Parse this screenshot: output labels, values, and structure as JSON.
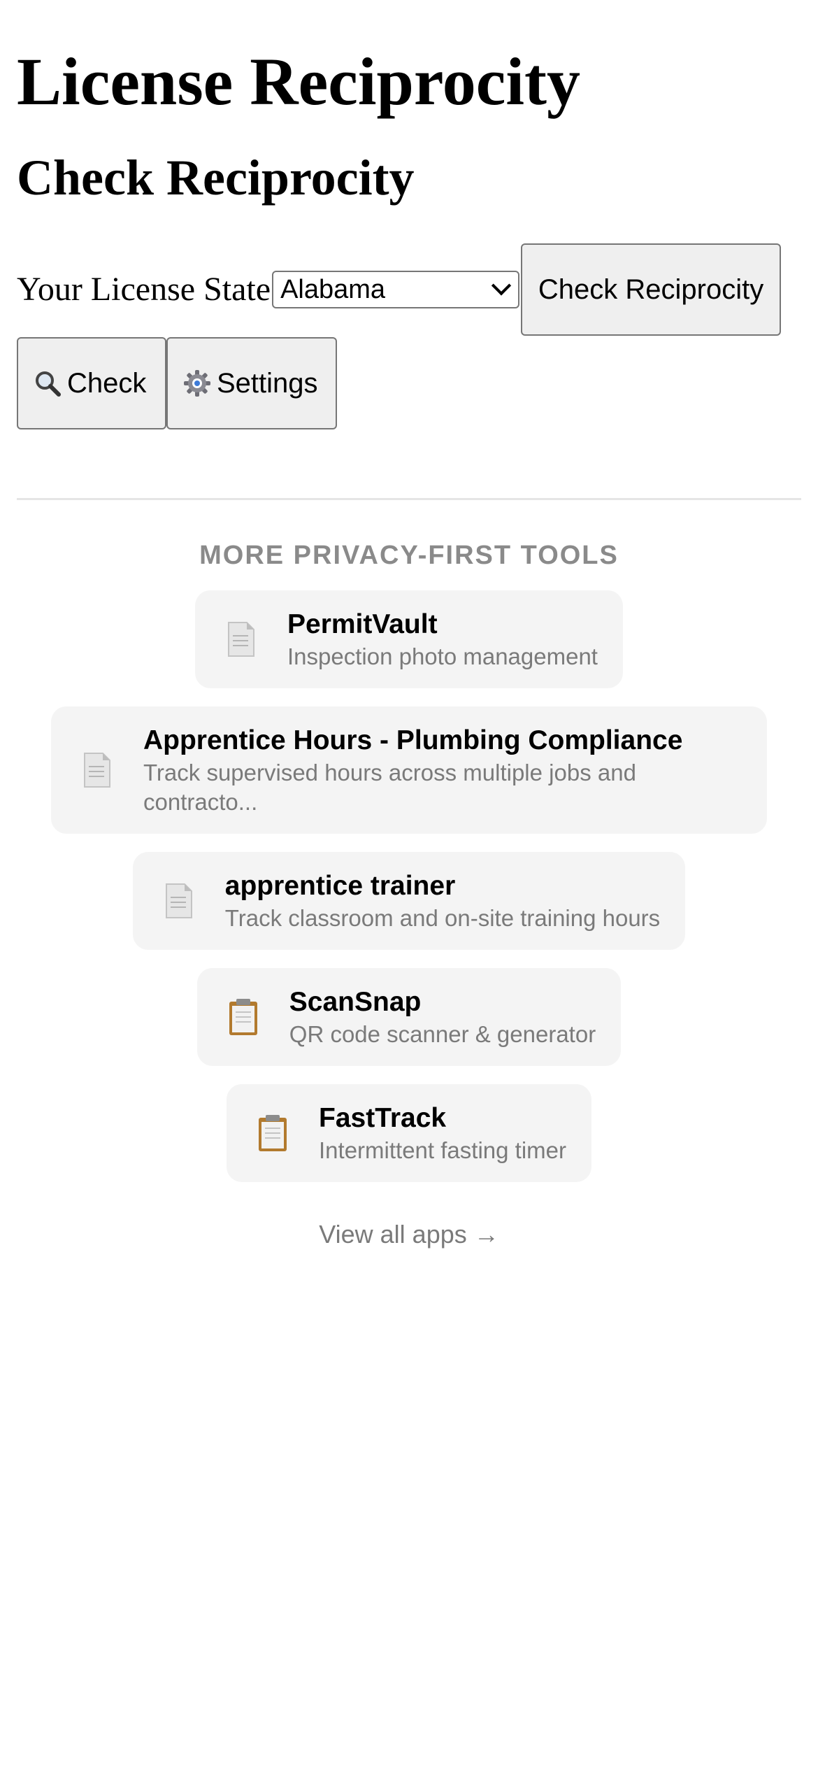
{
  "header": {
    "title": "License Reciprocity",
    "subtitle": "Check Reciprocity"
  },
  "form": {
    "state_label": "Your License State",
    "state_selected": "Alabama",
    "check_reciprocity_label": "Check Reciprocity"
  },
  "nav": {
    "check_label": "Check",
    "check_icon": "magnifier-icon",
    "settings_label": "Settings",
    "settings_icon": "gear-icon"
  },
  "more_tools": {
    "heading": "MORE PRIVACY-FIRST TOOLS",
    "items": [
      {
        "name": "PermitVault",
        "desc": "Inspection photo management",
        "icon": "document-icon"
      },
      {
        "name": "Apprentice Hours - Plumbing Compliance",
        "desc": "Track supervised hours across multiple jobs and contracto...",
        "icon": "document-icon"
      },
      {
        "name": "apprentice trainer",
        "desc": "Track classroom and on-site training hours",
        "icon": "document-icon"
      },
      {
        "name": "ScanSnap",
        "desc": "QR code scanner & generator",
        "icon": "clipboard-icon"
      },
      {
        "name": "FastTrack",
        "desc": "Intermittent fasting timer",
        "icon": "clipboard-icon"
      }
    ],
    "view_all": "View all apps →"
  }
}
